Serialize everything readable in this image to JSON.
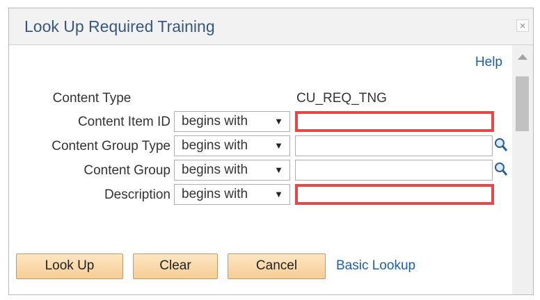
{
  "dialog": {
    "title": "Look Up Required Training",
    "close_label": "×",
    "help_label": "Help"
  },
  "fields": {
    "content_type": {
      "label": "Content Type",
      "value": "CU_REQ_TNG"
    },
    "content_item_id": {
      "label": "Content Item ID",
      "operator": "begins with",
      "value": ""
    },
    "content_group_type": {
      "label": "Content Group Type",
      "operator": "begins with",
      "value": ""
    },
    "content_group": {
      "label": "Content Group",
      "operator": "begins with",
      "value": ""
    },
    "description": {
      "label": "Description",
      "operator": "begins with",
      "value": ""
    }
  },
  "dropdown_arrow": "▼",
  "buttons": {
    "lookup": "Look Up",
    "clear": "Clear",
    "cancel": "Cancel",
    "basic_lookup": "Basic Lookup"
  },
  "colors": {
    "title": "#37577e",
    "link": "#1f5ea8",
    "highlight": "#e8474a",
    "button_fill": "#f7cd94"
  },
  "icons": {
    "close": "close-icon",
    "lookup": "magnifier-icon",
    "scroll": "scroll-up-icon"
  }
}
